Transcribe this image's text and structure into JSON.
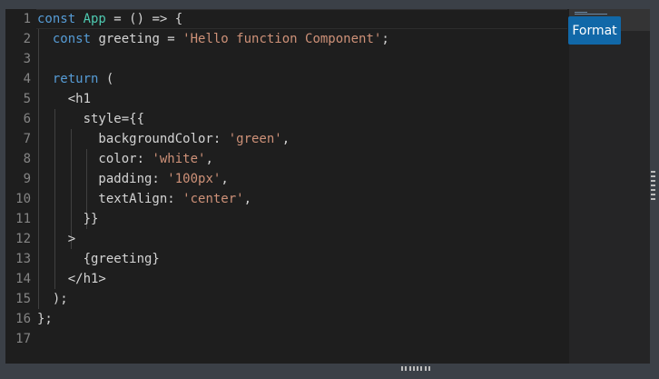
{
  "editor": {
    "line_numbers": [
      "1",
      "2",
      "3",
      "4",
      "5",
      "6",
      "7",
      "8",
      "9",
      "10",
      "11",
      "12",
      "13",
      "14",
      "15",
      "16",
      "17"
    ],
    "lines": [
      [
        {
          "t": "const ",
          "c": "kw"
        },
        {
          "t": "App",
          "c": "fn"
        },
        {
          "t": " = () => {",
          "c": ""
        }
      ],
      [
        {
          "t": "  const ",
          "c": "kw"
        },
        {
          "t": "greeting = ",
          "c": ""
        },
        {
          "t": "'Hello function Component'",
          "c": "str"
        },
        {
          "t": ";",
          "c": ""
        }
      ],
      [],
      [
        {
          "t": "  return ",
          "c": "kw"
        },
        {
          "t": "(",
          "c": ""
        }
      ],
      [
        {
          "t": "    <h1",
          "c": ""
        }
      ],
      [
        {
          "t": "      style={{",
          "c": ""
        }
      ],
      [
        {
          "t": "        backgroundColor: ",
          "c": ""
        },
        {
          "t": "'green'",
          "c": "str"
        },
        {
          "t": ",",
          "c": ""
        }
      ],
      [
        {
          "t": "        color: ",
          "c": ""
        },
        {
          "t": "'white'",
          "c": "str"
        },
        {
          "t": ",",
          "c": ""
        }
      ],
      [
        {
          "t": "        padding: ",
          "c": ""
        },
        {
          "t": "'100px'",
          "c": "str"
        },
        {
          "t": ",",
          "c": ""
        }
      ],
      [
        {
          "t": "        textAlign: ",
          "c": ""
        },
        {
          "t": "'center'",
          "c": "str"
        },
        {
          "t": ",",
          "c": ""
        }
      ],
      [
        {
          "t": "      }}",
          "c": ""
        }
      ],
      [
        {
          "t": "    >",
          "c": ""
        }
      ],
      [
        {
          "t": "      {greeting}",
          "c": ""
        }
      ],
      [
        {
          "t": "    </h1>",
          "c": ""
        }
      ],
      [
        {
          "t": "  );",
          "c": ""
        }
      ],
      [
        {
          "t": "};",
          "c": ""
        }
      ],
      []
    ]
  },
  "toolbar": {
    "format_label": "Format"
  },
  "colors": {
    "keyword": "#569cd6",
    "identifier": "#4ec9b0",
    "string": "#ce9178",
    "text": "#d4d4d4",
    "line_number": "#858585",
    "editor_bg": "#1e1e1e",
    "button_bg": "#1168a8"
  }
}
